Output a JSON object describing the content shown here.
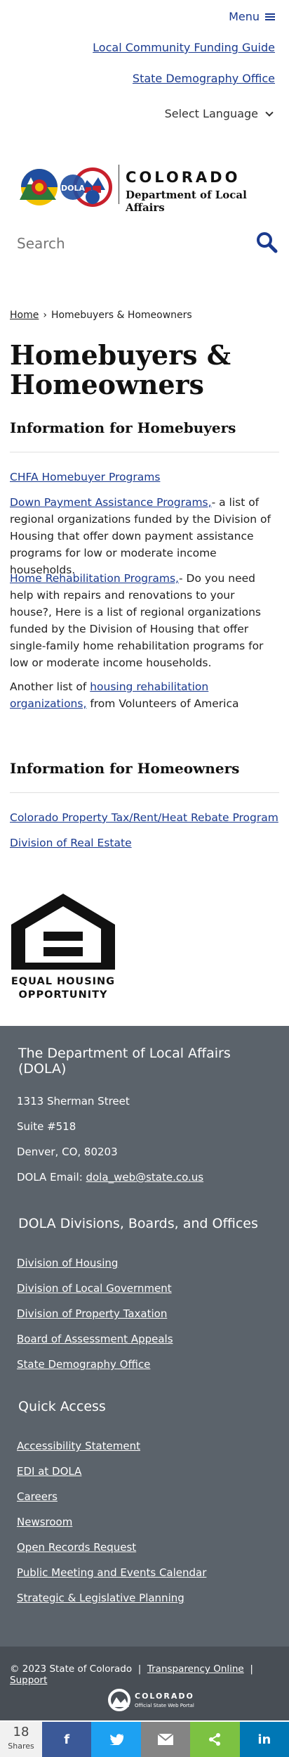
{
  "header": {
    "menu_label": "Menu",
    "links": [
      "Local Community Funding Guide",
      "State Demography Office"
    ],
    "language_label": "Select Language"
  },
  "logo": {
    "line1": "COLORADO",
    "line2": "Department of Local Affairs",
    "badge": "DOLA"
  },
  "search": {
    "placeholder": "Search"
  },
  "breadcrumb": {
    "home": "Home",
    "current": "Homebuyers & Homeowners"
  },
  "page_title": "Homebuyers & Homeowners",
  "homebuyers": {
    "heading": "Information for Homebuyers",
    "chfa_link": "CHFA Homebuyer Programs",
    "dpa_link": "Down Payment Assistance Programs,",
    "dpa_text": "- a list of regional organizations funded by the Division of Housing that offer down payment assistance programs for low or moderate income households.",
    "rehab_link": "Home Rehabilitation Programs,",
    "rehab_text": "- Do you need help with repairs and renovations to your house?, Here is a list of regional organizations funded by the Division of Housing that offer single-family home rehabilitation programs for low or moderate income households.",
    "another_prefix": "Another list of ",
    "another_link": "housing rehabilitation organizations,",
    "another_suffix": " from Volunteers of America"
  },
  "homeowners": {
    "heading": "Information for Homeowners",
    "links": [
      "Colorado Property Tax/Rent/Heat Rebate Program",
      "Division of Real Estate"
    ]
  },
  "eho": {
    "line1": "EQUAL HOUSING",
    "line2": "OPPORTUNITY"
  },
  "footer": {
    "dept_heading": "The Department of Local Affairs (DOLA)",
    "address": [
      "1313 Sherman Street",
      "Suite  #518",
      "Denver, CO, 80203"
    ],
    "email_label": "DOLA Email: ",
    "email": "dola_web@state.co.us",
    "divisions_heading": "DOLA Divisions, Boards, and Offices",
    "divisions": [
      "Division of Housing",
      "Division of Local Government",
      "Division of Property Taxation",
      "Board of Assessment Appeals",
      "State Demography Office"
    ],
    "quick_heading": "Quick Access",
    "quick": [
      "Accessibility Statement",
      "EDI at DOLA",
      "Careers",
      "Newsroom",
      "Open Records Request",
      "Public Meeting and Events Calendar",
      "Strategic & Legislative Planning"
    ]
  },
  "bottom": {
    "copyright": "© 2023 State of Colorado",
    "links": [
      "Transparency Online",
      "Support"
    ],
    "state_logo_line1": "COLORADO",
    "state_logo_line2": "Official State Web Portal"
  },
  "share": {
    "count": "18",
    "count_label": "Shares",
    "buttons": [
      {
        "name": "facebook",
        "glyph": "f",
        "color": "#3b5998"
      },
      {
        "name": "twitter",
        "glyph": "🐦",
        "color": "#1da1f2"
      },
      {
        "name": "email",
        "glyph": "✉",
        "color": "#848484"
      },
      {
        "name": "share",
        "glyph": "<",
        "color": "#7cc242"
      },
      {
        "name": "linkedin",
        "glyph": "in",
        "color": "#0077b5"
      }
    ]
  }
}
